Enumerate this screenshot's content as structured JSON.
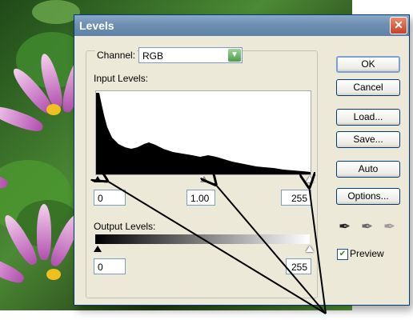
{
  "dialog": {
    "title": "Levels",
    "channel_label": "Channel:",
    "channel_value": "RGB",
    "input_levels_label": "Input Levels:",
    "input_black": "0",
    "input_gamma": "1.00",
    "input_white": "255",
    "output_levels_label": "Output Levels:",
    "output_black": "0",
    "output_white": "255",
    "buttons": {
      "ok": "OK",
      "cancel": "Cancel",
      "load": "Load...",
      "save": "Save...",
      "auto": "Auto",
      "options": "Options..."
    },
    "preview_label": "Preview",
    "preview_checked": true
  },
  "icons": {
    "close": "close-icon",
    "dropdown": "chevron-down-icon",
    "eyedropper_black": "eyedropper-black-icon",
    "eyedropper_gray": "eyedropper-gray-icon",
    "eyedropper_white": "eyedropper-white-icon"
  },
  "colors": {
    "titlebar": "#6f8fb2",
    "dialog_bg": "#ece9d8",
    "close_red": "#c4432a"
  }
}
